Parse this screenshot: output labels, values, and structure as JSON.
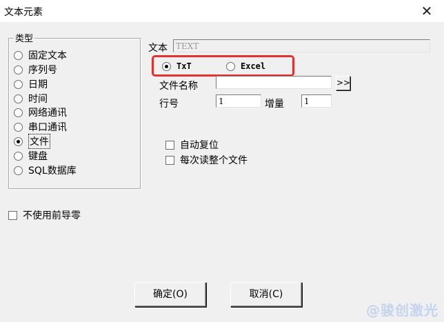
{
  "window": {
    "title": "文本元素",
    "close_glyph": "✕"
  },
  "type_group": {
    "legend": "类型",
    "options": [
      {
        "label": "固定文本",
        "checked": false
      },
      {
        "label": "序列号",
        "checked": false
      },
      {
        "label": "日期",
        "checked": false
      },
      {
        "label": "时间",
        "checked": false
      },
      {
        "label": "网络通讯",
        "checked": false
      },
      {
        "label": "串口通讯",
        "checked": false
      },
      {
        "label": "文件",
        "checked": true
      },
      {
        "label": "键盘",
        "checked": false
      },
      {
        "label": "SQL数据库",
        "checked": false
      }
    ]
  },
  "text_field": {
    "label": "文本",
    "value": "TEXT"
  },
  "file_type": {
    "options": [
      {
        "label": "TxT",
        "checked": true
      },
      {
        "label": "Excel",
        "checked": false
      }
    ],
    "highlight_color": "#e53030"
  },
  "file_name": {
    "label": "文件名称",
    "value": "",
    "browse_label": ">>"
  },
  "line_no": {
    "label": "行号",
    "value": "1"
  },
  "increment": {
    "label": "增量",
    "value": "1"
  },
  "checkboxes": {
    "auto_reset": "自动复位",
    "read_whole_file": "每次读整个文件",
    "no_leading_zero": "不使用前导零"
  },
  "buttons": {
    "ok": "确定(O)",
    "cancel": "取消(C)"
  },
  "watermark": "@骏创激光"
}
